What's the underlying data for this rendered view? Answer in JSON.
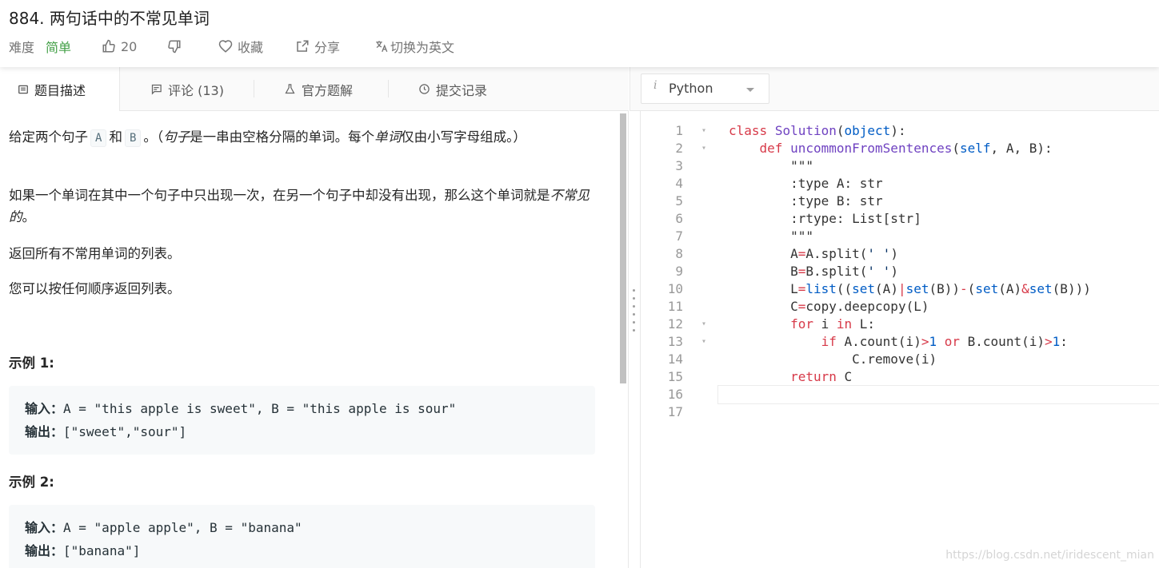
{
  "problem": {
    "title": "884. 两句话中的不常见单词",
    "difficulty_label": "难度",
    "difficulty_value": "简单",
    "likes": "20",
    "favorite_label": "收藏",
    "share_label": "分享",
    "switch_lang_label": "切换为英文"
  },
  "tabs": [
    {
      "label": "题目描述",
      "icon": "description-icon",
      "active": true
    },
    {
      "label": "评论 (13)",
      "icon": "comment-icon",
      "active": false
    },
    {
      "label": "官方题解",
      "icon": "flask-icon",
      "active": false
    },
    {
      "label": "提交记录",
      "icon": "clock-icon",
      "active": false
    }
  ],
  "description": {
    "p1_a": "给定两个句子",
    "p1_var_a": "A",
    "p1_and": "和",
    "p1_var_b": "B",
    "p1_b": "。（",
    "p1_em1": "句子",
    "p1_c": "是一串由空格分隔的单词。每个",
    "p1_em2": "单词",
    "p1_d": "仅由小写字母组成。）",
    "p2_a": "如果一个单词在其中一个句子中只出现一次，在另一个句子中却没有出现，那么这个单词就是",
    "p2_em": "不常见的",
    "p2_b": "。",
    "p3": "返回所有不常用单词的列表。",
    "p4": "您可以按任何顺序返回列表。"
  },
  "examples": [
    {
      "title": "示例 1:",
      "input_label": "输入：",
      "input": "A = \"this apple is sweet\", B = \"this apple is sour\"",
      "output_label": "输出：",
      "output": "[\"sweet\",\"sour\"]"
    },
    {
      "title": "示例 2:",
      "input_label": "输入：",
      "input": "A = \"apple apple\", B = \"banana\"",
      "output_label": "输出：",
      "output": "[\"banana\"]"
    }
  ],
  "editor": {
    "language": "Python",
    "info_glyph": "i",
    "lines": [
      {
        "n": "1",
        "fold": true,
        "code": "class Solution(object):"
      },
      {
        "n": "2",
        "fold": true,
        "code": "    def uncommonFromSentences(self, A, B):"
      },
      {
        "n": "3",
        "fold": false,
        "code": "        \"\"\""
      },
      {
        "n": "4",
        "fold": false,
        "code": "        :type A: str"
      },
      {
        "n": "5",
        "fold": false,
        "code": "        :type B: str"
      },
      {
        "n": "6",
        "fold": false,
        "code": "        :rtype: List[str]"
      },
      {
        "n": "7",
        "fold": false,
        "code": "        \"\"\""
      },
      {
        "n": "8",
        "fold": false,
        "code": "        A=A.split(' ')"
      },
      {
        "n": "9",
        "fold": false,
        "code": "        B=B.split(' ')"
      },
      {
        "n": "10",
        "fold": false,
        "code": "        L=list((set(A)|set(B))-(set(A)&set(B)))"
      },
      {
        "n": "11",
        "fold": false,
        "code": "        C=copy.deepcopy(L)"
      },
      {
        "n": "12",
        "fold": true,
        "code": "        for i in L:"
      },
      {
        "n": "13",
        "fold": true,
        "code": "            if A.count(i)>1 or B.count(i)>1:"
      },
      {
        "n": "14",
        "fold": false,
        "code": "                C.remove(i)"
      },
      {
        "n": "15",
        "fold": false,
        "code": "        return C"
      },
      {
        "n": "16",
        "fold": false,
        "code": ""
      },
      {
        "n": "17",
        "fold": false,
        "code": ""
      }
    ]
  },
  "watermark": "https://blog.csdn.net/iridescent_mian"
}
